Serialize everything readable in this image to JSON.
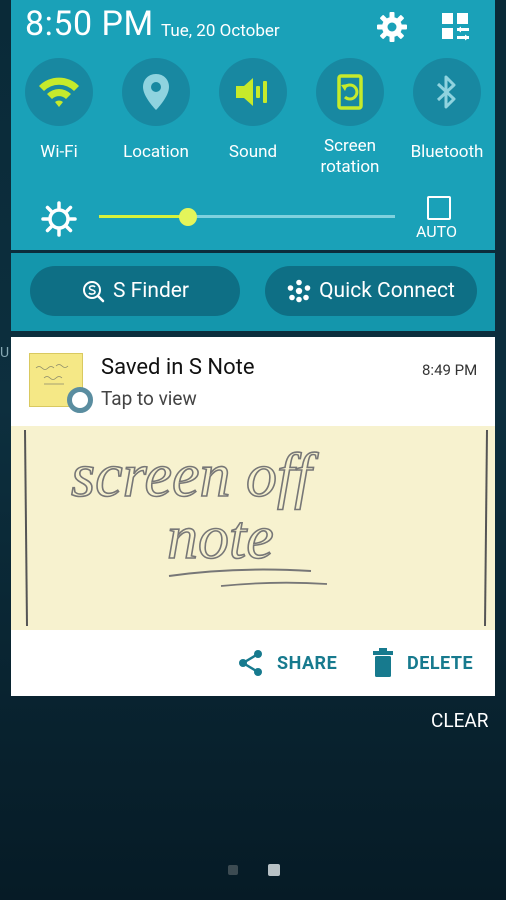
{
  "status": {
    "time": "8:50 PM",
    "date": "Tue, 20 October"
  },
  "top_icons": [
    "gear-icon",
    "edit-grid-icon"
  ],
  "toggles": [
    {
      "label": "Wi-Fi",
      "icon": "wifi-icon",
      "active": true
    },
    {
      "label": "Location",
      "icon": "location-icon",
      "active": false
    },
    {
      "label": "Sound",
      "icon": "sound-icon",
      "active": true
    },
    {
      "label": "Screen\nrotation",
      "icon": "rotation-icon",
      "active": true
    },
    {
      "label": "Bluetooth",
      "icon": "bluetooth-icon",
      "active": false
    }
  ],
  "brightness": {
    "level": 0.3,
    "auto_label": "AUTO"
  },
  "buttons": {
    "finder": "S Finder",
    "quick_connect": "Quick Connect"
  },
  "notification": {
    "title": "Saved in S Note",
    "subtitle": "Tap to view",
    "time": "8:49 PM",
    "handwriting_line1": "screen off",
    "handwriting_line2": "note",
    "share_label": "SHARE",
    "delete_label": "DELETE"
  },
  "clear_label": "CLEAR",
  "edge_char": "U",
  "colors": {
    "panel": "#1aa1b8",
    "accent_active": "#c6ea2b",
    "action": "#177a8e"
  }
}
